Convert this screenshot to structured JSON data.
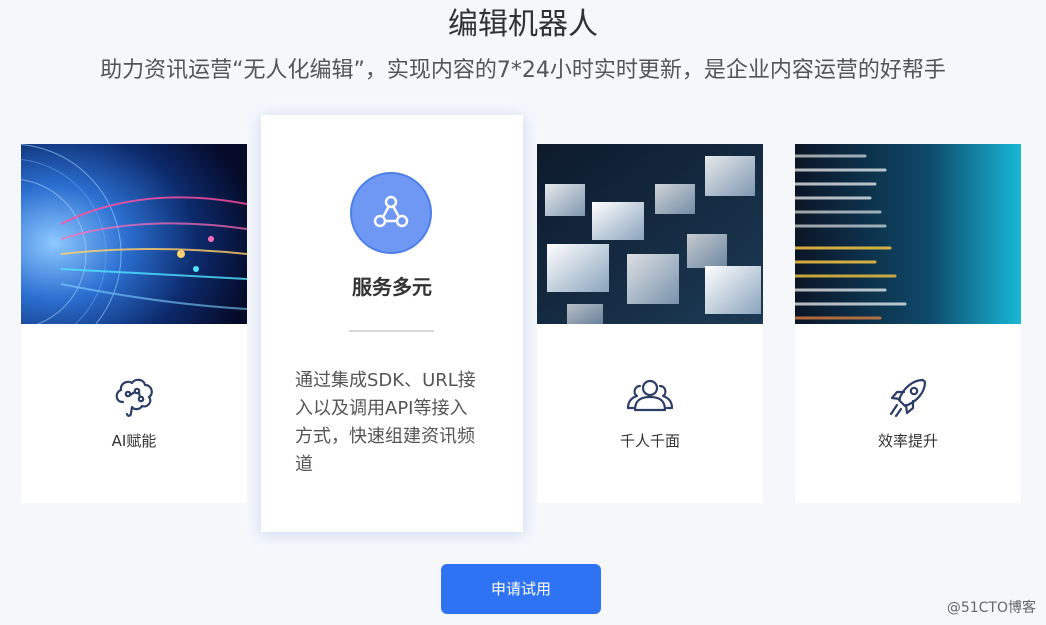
{
  "header": {
    "title": "编辑机器人",
    "subtitle": "助力资讯运营“无人化编辑”，实现内容的7*24小时实时更新，是企业内容运营的好帮手"
  },
  "cards": [
    {
      "label": "AI赋能",
      "icon": "brain-icon"
    },
    {
      "label": "千人千面",
      "icon": "users-icon"
    },
    {
      "label": "效率提升",
      "icon": "rocket-icon"
    }
  ],
  "feature": {
    "title": "服务多元",
    "description_lines": [
      "通过集成SDK、URL接",
      "入以及调用API等接入",
      "方式，快速组建资讯频",
      "道"
    ],
    "icon": "share-nodes-icon"
  },
  "cta": {
    "label": "申请试用"
  },
  "watermark": "@51CTO博客",
  "colors": {
    "background": "#f5f7fb",
    "accent": "#2f73f5",
    "icon_circle": "#6f98f5",
    "icon_stroke": "#2c3e66"
  }
}
